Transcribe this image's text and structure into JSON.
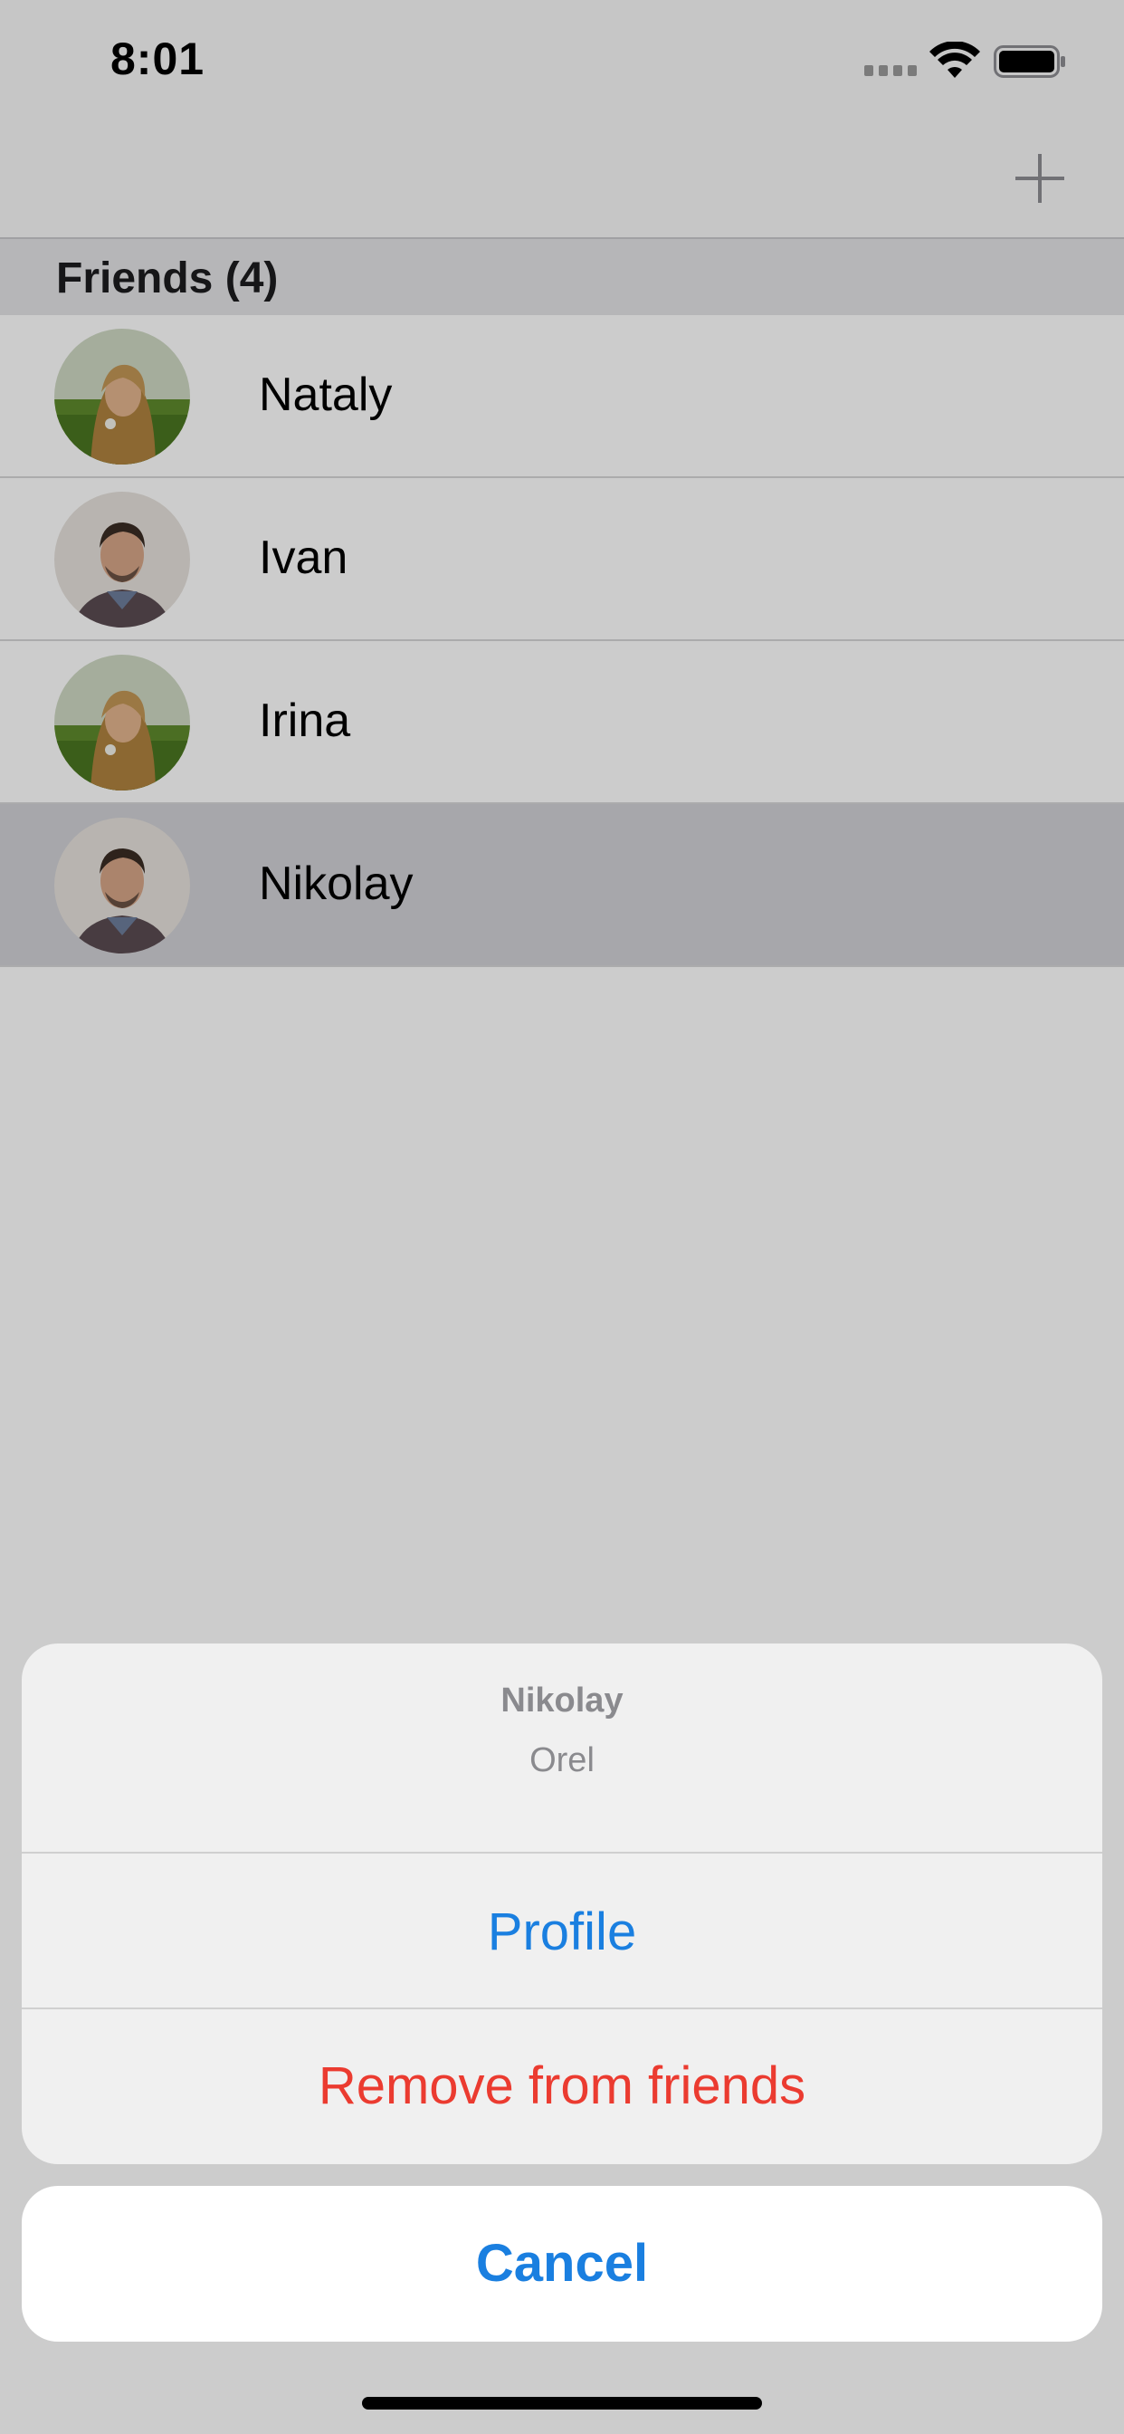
{
  "status_bar": {
    "time": "8:01"
  },
  "nav_bar": {
    "add_icon": "plus-icon"
  },
  "section": {
    "title": "Friends (4)"
  },
  "friends": [
    {
      "name": "Nataly",
      "avatar": "woman-avatar",
      "selected": false
    },
    {
      "name": "Ivan",
      "avatar": "man-avatar",
      "selected": false
    },
    {
      "name": "Irina",
      "avatar": "woman-avatar",
      "selected": false
    },
    {
      "name": "Nikolay",
      "avatar": "man-avatar",
      "selected": true
    }
  ],
  "action_sheet": {
    "title": "Nikolay",
    "subtitle": "Orel",
    "profile_label": "Profile",
    "remove_label": "Remove from friends",
    "cancel_label": "Cancel"
  },
  "colors": {
    "accent_blue": "#1a7fe0",
    "destructive_red": "#eb3b30",
    "selected_row": "#d1d1d6"
  }
}
